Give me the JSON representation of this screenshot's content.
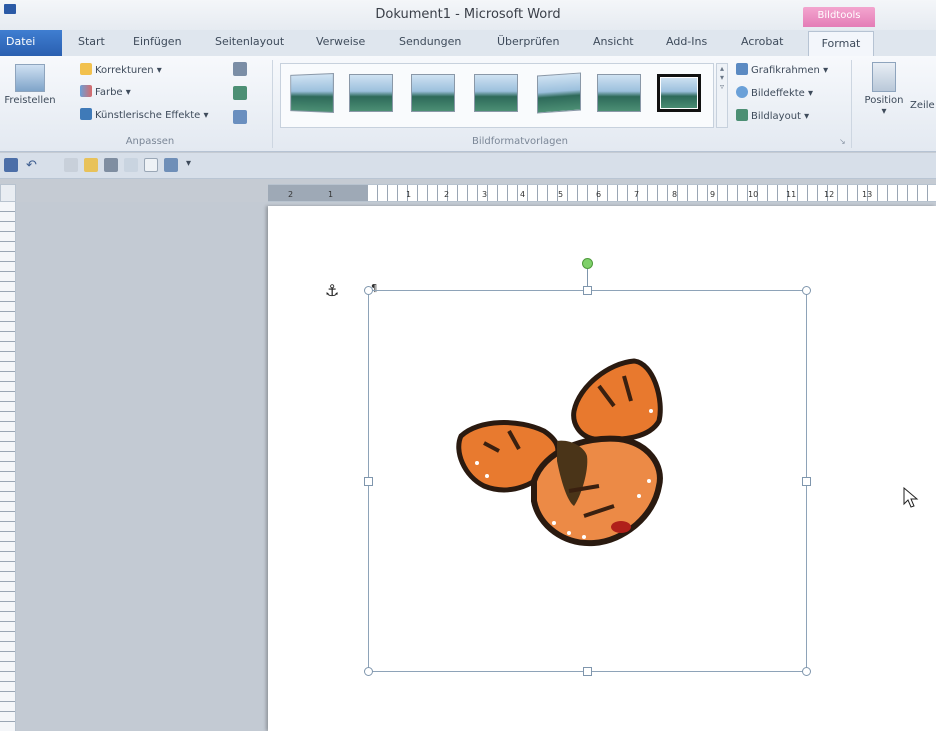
{
  "window": {
    "title": "Dokument1 - Microsoft Word",
    "context_tab_group": "Bildtools"
  },
  "tabs": [
    "Datei",
    "Start",
    "Einfügen",
    "Seitenlayout",
    "Verweise",
    "Sendungen",
    "Überprüfen",
    "Ansicht",
    "Add-Ins",
    "Acrobat",
    "Format"
  ],
  "ribbon": {
    "freistellen": "Freistellen",
    "anpassen": {
      "label": "Anpassen",
      "korrekturen": "Korrekturen ▾",
      "farbe": "Farbe ▾",
      "kuenstlerische_effekte": "Künstlerische Effekte ▾"
    },
    "bildformatvorlagen": {
      "label": "Bildformatvorlagen",
      "selected_index": 6,
      "count": 7
    },
    "right": {
      "grafikrahmen": "Grafikrahmen ▾",
      "bildeffekte": "Bildeffekte ▾",
      "bildlayout": "Bildlayout ▾"
    },
    "position": "Position",
    "zeilenumbruch": "Zeile"
  },
  "ruler": {
    "labels": [
      "2",
      "1",
      "1",
      "2",
      "3",
      "4",
      "5",
      "6",
      "7",
      "8",
      "9",
      "10",
      "11",
      "12",
      "13"
    ]
  },
  "colors": {
    "datei_tab": "#2a5fb0",
    "context_header": "#e47cb6",
    "rotation_handle": "#7fd06a",
    "butterfly_orange": "#e87a2f"
  },
  "icons": {
    "anchor": "⚓",
    "paragraph_mark": "¶"
  }
}
